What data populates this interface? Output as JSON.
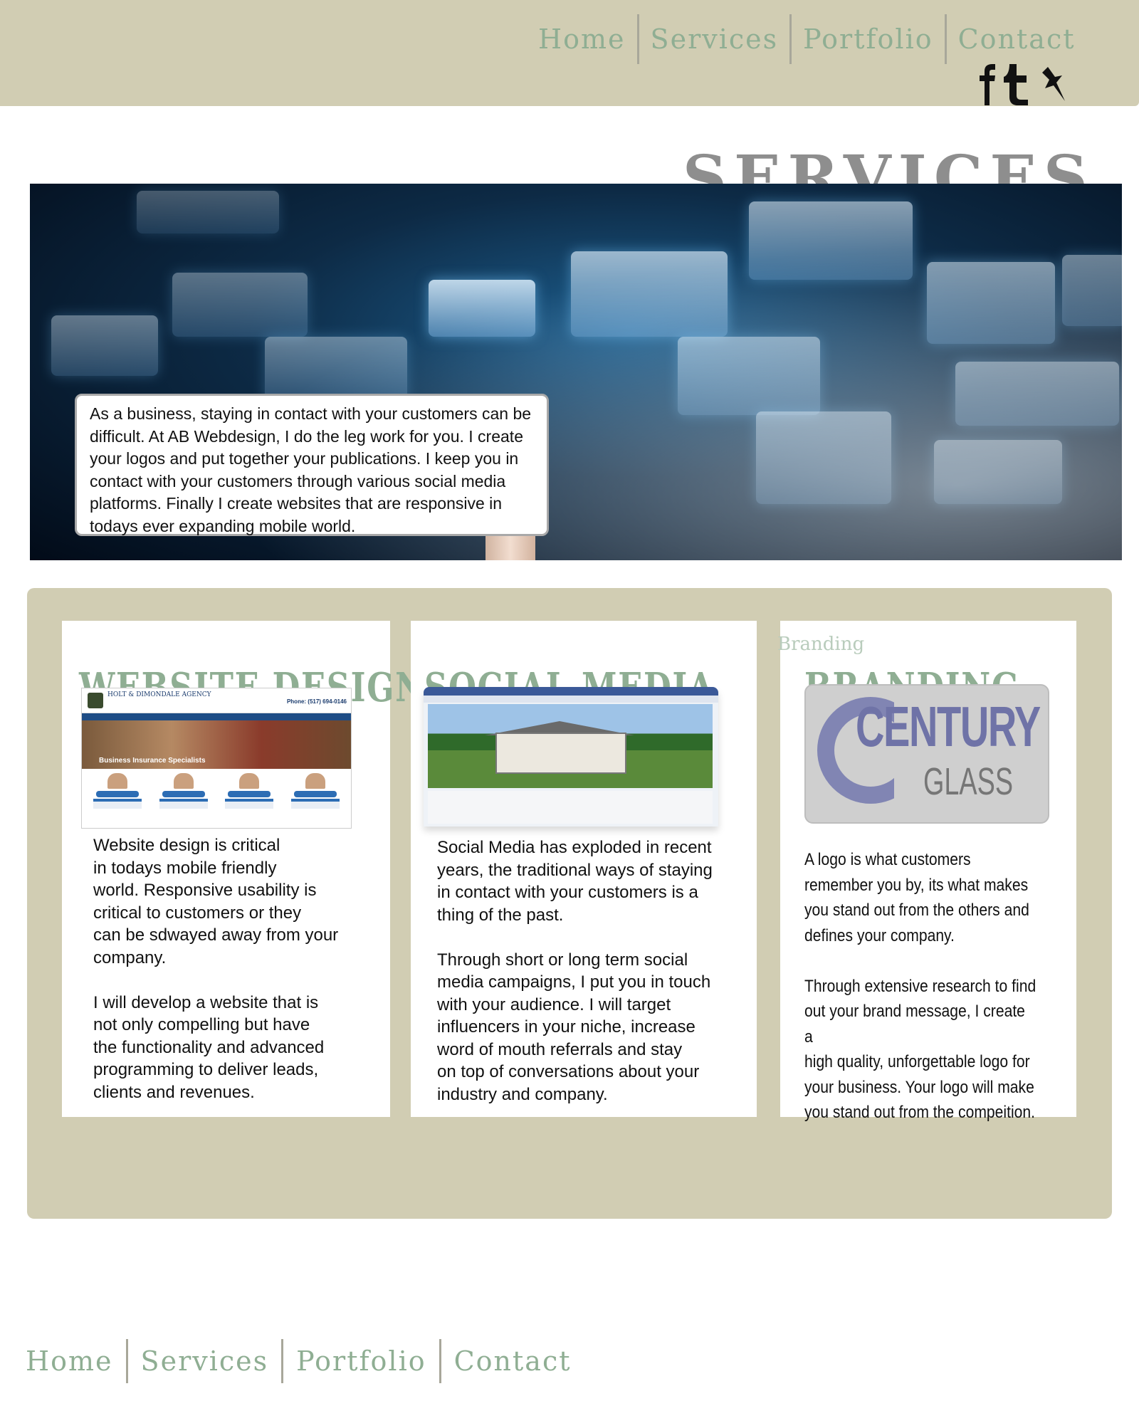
{
  "nav": {
    "items": [
      {
        "label": "Home"
      },
      {
        "label": "Services"
      },
      {
        "label": "Portfolio"
      },
      {
        "label": "Contact"
      }
    ]
  },
  "social": {
    "icons": [
      "facebook-icon",
      "tumblr-icon",
      "pushpin-icon"
    ]
  },
  "page": {
    "title": "SERVICES"
  },
  "hero": {
    "intro": "As a business, staying in contact with your customers can be difficult. At AB Webdesign, I do the leg work for you. I create your logos and put together your publications. I keep you in contact with your customers through various social media platforms. Finally I create websites that are responsive in todays ever expanding mobile world."
  },
  "services": [
    {
      "title": "WEBSITE DESIGN",
      "text": "Website design is critical\nin todays mobile friendly\nworld. Responsive usability is\ncritical to customers or they\ncan be sdwayed away from your\ncompany.\n\nI will develop a website that is\nnot only compelling but have\nthe functionality and advanced\nprogramming to deliver leads,\nclients and revenues.",
      "screenshot": {
        "agency": "HOLT & DIMONDALE AGENCY",
        "phone": "Phone: (517) 694-0146",
        "banner": "Business Insurance Specialists"
      }
    },
    {
      "title": "SOCIAL MEDIA",
      "text": "Social Media has exploded in recent\nyears, the traditional ways of staying\nin contact with your customers is a\nthing of the past.\n\nThrough short or long term social\nmedia campaigns, I put you in touch\nwith your audience. I will target\ninfluencers in your niche, increase\nword of mouth referrals and stay\non top of conversations about your\nindustry and company."
    },
    {
      "title": "BRANDING",
      "ghost": "Branding",
      "logo": {
        "line1": "CENTURY",
        "line2": "GLASS"
      },
      "text": "A logo is what customers\n remember you by, its what makes\nyou stand out from the others and\ndefines your company.\n\nThrough extensive research to find\nout your brand message, I create a\nhigh quality,  unforgettable logo for\nyour business.  Your logo will make\nyou stand out from the compeition."
    }
  ],
  "colors": {
    "tan": "#d1cdb3",
    "nav_green": "#8fae93",
    "title_gray": "#8e8e8e",
    "logo_purple": "#6f73a7"
  }
}
